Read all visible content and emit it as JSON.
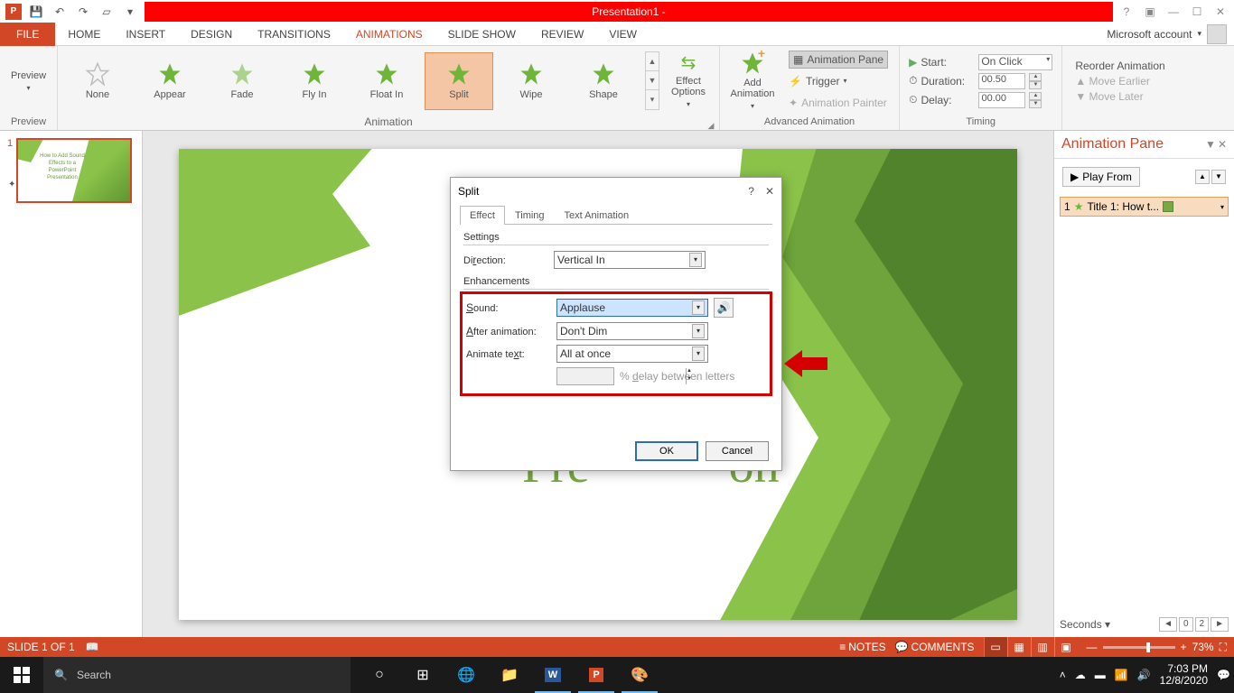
{
  "titlebar": {
    "doc": "Presentation1 - "
  },
  "menutabs": {
    "file": "FILE",
    "home": "HOME",
    "insert": "INSERT",
    "design": "DESIGN",
    "transitions": "TRANSITIONS",
    "animations": "ANIMATIONS",
    "slideshow": "SLIDE SHOW",
    "review": "REVIEW",
    "view": "VIEW",
    "account": "Microsoft account"
  },
  "ribbon": {
    "preview": {
      "label": "Preview",
      "group": "Preview"
    },
    "animation": {
      "group": "Animation",
      "items": [
        "None",
        "Appear",
        "Fade",
        "Fly In",
        "Float In",
        "Split",
        "Wipe",
        "Shape"
      ],
      "effect_options": "Effect\nOptions"
    },
    "advanced": {
      "group": "Advanced Animation",
      "add": "Add\nAnimation",
      "pane": "Animation Pane",
      "trigger": "Trigger",
      "painter": "Animation Painter"
    },
    "timing": {
      "group": "Timing",
      "start_lbl": "Start:",
      "start_val": "On Click",
      "duration_lbl": "Duration:",
      "duration_val": "00.50",
      "delay_lbl": "Delay:",
      "delay_val": "00.00"
    },
    "reorder": {
      "title": "Reorder Animation",
      "earlier": "Move Earlier",
      "later": "Move Later"
    }
  },
  "thumb": {
    "num": "1",
    "text": "How to Add Sound\nEffects to a\nPowerPoint\nPresentation"
  },
  "slide": {
    "num_box": "1",
    "title": "How\nE\nP\nPre           on"
  },
  "ap": {
    "title": "Animation Pane",
    "play": "Play From",
    "item_num": "1",
    "item_text": "Title 1: How t...",
    "seconds": "Seconds",
    "nav0": "0",
    "nav2": "2"
  },
  "dialog": {
    "title": "Split",
    "tabs": {
      "effect": "Effect",
      "timing": "Timing",
      "textanim": "Text Animation"
    },
    "settings": "Settings",
    "direction_lbl": "Direction:",
    "direction_val": "Vertical In",
    "enh": "Enhancements",
    "sound_lbl": "Sound:",
    "sound_val": "Applause",
    "after_lbl": "After animation:",
    "after_val": "Don't Dim",
    "animtext_lbl": "Animate text:",
    "animtext_val": "All at once",
    "delay_hint": "% delay between letters",
    "ok": "OK",
    "cancel": "Cancel"
  },
  "status": {
    "slide": "SLIDE 1 OF 1",
    "notes": "NOTES",
    "comments": "COMMENTS",
    "zoom": "73%"
  },
  "taskbar": {
    "search_ph": "Search",
    "time": "7:03 PM",
    "date": "12/8/2020"
  }
}
